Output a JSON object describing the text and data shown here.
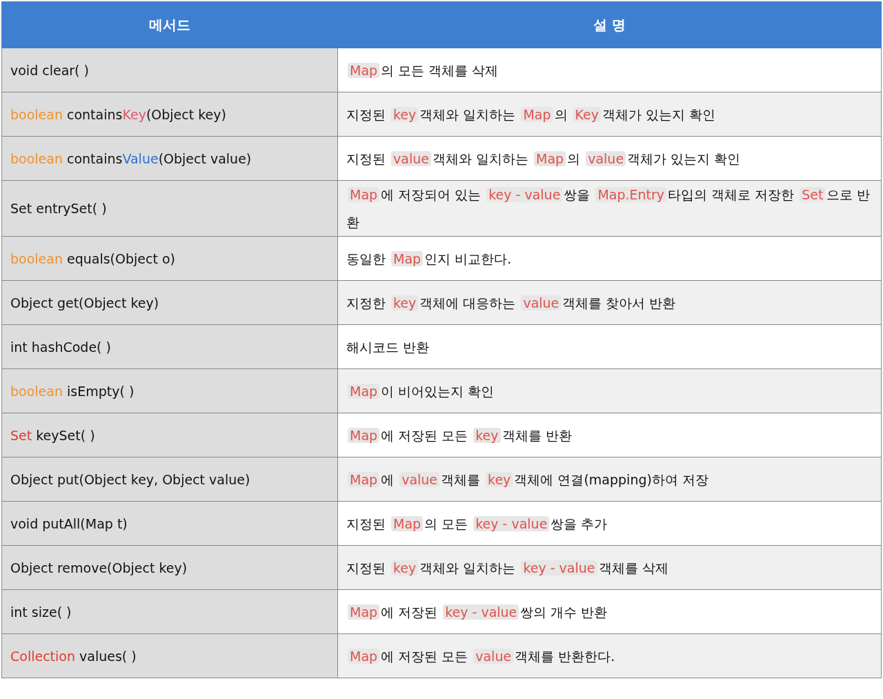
{
  "table": {
    "columns": [
      "메서드",
      "설 명"
    ],
    "rows": [
      {
        "method": [
          {
            "text": "void clear( )"
          }
        ],
        "description": [
          {
            "kind": "code",
            "text": "Map"
          },
          {
            "kind": "text",
            "text": "의 모든 객체를 삭제"
          }
        ]
      },
      {
        "method": [
          {
            "text": "boolean",
            "color": "#f0922e"
          },
          {
            "text": " contains"
          },
          {
            "text": "Key",
            "color": "#e2566a"
          },
          {
            "text": "(Object key)"
          }
        ],
        "description": [
          {
            "kind": "text",
            "text": "지정된 "
          },
          {
            "kind": "code",
            "text": "key"
          },
          {
            "kind": "text",
            "text": "객체와 일치하는 "
          },
          {
            "kind": "code",
            "text": "Map"
          },
          {
            "kind": "text",
            "text": "의 "
          },
          {
            "kind": "code",
            "text": "Key"
          },
          {
            "kind": "text",
            "text": "객체가 있는지 확인"
          }
        ]
      },
      {
        "method": [
          {
            "text": "boolean",
            "color": "#f0922e"
          },
          {
            "text": " contains"
          },
          {
            "text": "Value",
            "color": "#2f6fd6"
          },
          {
            "text": "(Object value)"
          }
        ],
        "description": [
          {
            "kind": "text",
            "text": "지정된 "
          },
          {
            "kind": "code",
            "text": "value"
          },
          {
            "kind": "text",
            "text": "객체와 일치하는 "
          },
          {
            "kind": "code",
            "text": "Map"
          },
          {
            "kind": "text",
            "text": "의 "
          },
          {
            "kind": "code",
            "text": "value"
          },
          {
            "kind": "text",
            "text": "객체가 있는지 확인"
          }
        ]
      },
      {
        "method": [
          {
            "text": "Set entrySet( )"
          }
        ],
        "description": [
          {
            "kind": "code",
            "text": "Map"
          },
          {
            "kind": "text",
            "text": "에 저장되어 있는 "
          },
          {
            "kind": "code",
            "text": "key - value"
          },
          {
            "kind": "text",
            "text": "쌍을 "
          },
          {
            "kind": "code",
            "text": "Map.Entry"
          },
          {
            "kind": "text",
            "text": "타입의 객체로 저장한 "
          },
          {
            "kind": "code",
            "text": "Set"
          },
          {
            "kind": "text",
            "text": "으로 반환"
          }
        ]
      },
      {
        "method": [
          {
            "text": "boolean",
            "color": "#f0922e"
          },
          {
            "text": " equals(Object o)"
          }
        ],
        "description": [
          {
            "kind": "text",
            "text": "동일한 "
          },
          {
            "kind": "code",
            "text": "Map"
          },
          {
            "kind": "text",
            "text": "인지 비교한다."
          }
        ]
      },
      {
        "method": [
          {
            "text": "Object get(Object key)"
          }
        ],
        "description": [
          {
            "kind": "text",
            "text": "지정한 "
          },
          {
            "kind": "code",
            "text": "key"
          },
          {
            "kind": "text",
            "text": "객체에 대응하는 "
          },
          {
            "kind": "code",
            "text": "value"
          },
          {
            "kind": "text",
            "text": "객체를 찾아서 반환"
          }
        ]
      },
      {
        "method": [
          {
            "text": "int hashCode( )"
          }
        ],
        "description": [
          {
            "kind": "text",
            "text": "해시코드 반환"
          }
        ]
      },
      {
        "method": [
          {
            "text": "boolean",
            "color": "#f0922e"
          },
          {
            "text": " isEmpty( )"
          }
        ],
        "description": [
          {
            "kind": "code",
            "text": "Map"
          },
          {
            "kind": "text",
            "text": "이 비어있는지 확인"
          }
        ]
      },
      {
        "method": [
          {
            "text": "Set",
            "color": "#e23a2e"
          },
          {
            "text": " keySet( )"
          }
        ],
        "description": [
          {
            "kind": "code",
            "text": "Map"
          },
          {
            "kind": "text",
            "text": "에 저장된 모든 "
          },
          {
            "kind": "code",
            "text": "key"
          },
          {
            "kind": "text",
            "text": "객체를 반환"
          }
        ]
      },
      {
        "method": [
          {
            "text": "Object put(Object key, Object value)"
          }
        ],
        "description": [
          {
            "kind": "code",
            "text": "Map"
          },
          {
            "kind": "text",
            "text": "에 "
          },
          {
            "kind": "code",
            "text": "value"
          },
          {
            "kind": "text",
            "text": "객체를 "
          },
          {
            "kind": "code",
            "text": "key"
          },
          {
            "kind": "text",
            "text": "객체에 연결(mapping)하여 저장"
          }
        ]
      },
      {
        "method": [
          {
            "text": "void putAll(Map t)"
          }
        ],
        "description": [
          {
            "kind": "text",
            "text": "지정된 "
          },
          {
            "kind": "code",
            "text": "Map"
          },
          {
            "kind": "text",
            "text": "의 모든 "
          },
          {
            "kind": "code",
            "text": "key - value"
          },
          {
            "kind": "text",
            "text": "쌍을 추가"
          }
        ]
      },
      {
        "method": [
          {
            "text": "Object remove(Object key)"
          }
        ],
        "description": [
          {
            "kind": "text",
            "text": "지정된 "
          },
          {
            "kind": "code",
            "text": "key"
          },
          {
            "kind": "text",
            "text": "객체와 일치하는 "
          },
          {
            "kind": "code",
            "text": "key - value"
          },
          {
            "kind": "text",
            "text": "객체를 삭제"
          }
        ]
      },
      {
        "method": [
          {
            "text": "int size( )"
          }
        ],
        "description": [
          {
            "kind": "code",
            "text": "Map"
          },
          {
            "kind": "text",
            "text": "에 저장된 "
          },
          {
            "kind": "code",
            "text": "key - value"
          },
          {
            "kind": "text",
            "text": "쌍의 개수 반환"
          }
        ]
      },
      {
        "method": [
          {
            "text": "Collection",
            "color": "#e23a2e"
          },
          {
            "text": " values( )"
          }
        ],
        "description": [
          {
            "kind": "code",
            "text": "Map"
          },
          {
            "kind": "text",
            "text": "에 저장된 모든 "
          },
          {
            "kind": "code",
            "text": "value"
          },
          {
            "kind": "text",
            "text": "객체를 반환한다."
          }
        ]
      }
    ]
  }
}
